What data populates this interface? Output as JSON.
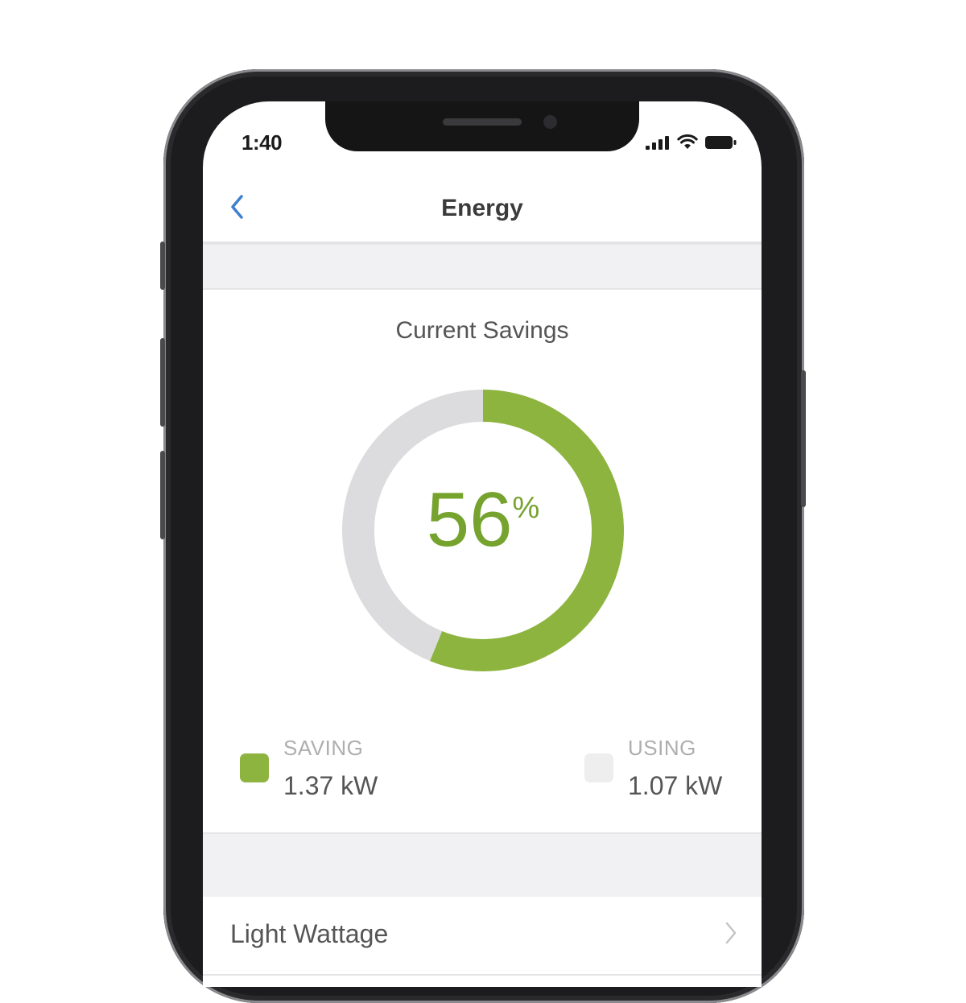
{
  "status_bar": {
    "time": "1:40",
    "icons": [
      "cellular-signal-icon",
      "wifi-icon",
      "battery-icon"
    ]
  },
  "nav": {
    "title": "Energy",
    "back_icon": "chevron-left-icon"
  },
  "savings": {
    "title": "Current Savings",
    "percent_value": "56",
    "percent_sign": "%",
    "saving_label": "SAVING",
    "saving_value": "1.37 kW",
    "using_label": "USING",
    "using_value": "1.07 kW"
  },
  "chart_data": {
    "type": "pie",
    "categories": [
      "SAVING",
      "USING"
    ],
    "values": [
      1.37,
      1.07
    ],
    "center_label": "56%"
  },
  "list": {
    "items": [
      {
        "label": "Light Wattage",
        "icon": "chevron-right-icon"
      }
    ]
  },
  "colors": {
    "saving": "#8db43e",
    "using": "#dcdcde",
    "accent_back": "#3f7fd0"
  }
}
